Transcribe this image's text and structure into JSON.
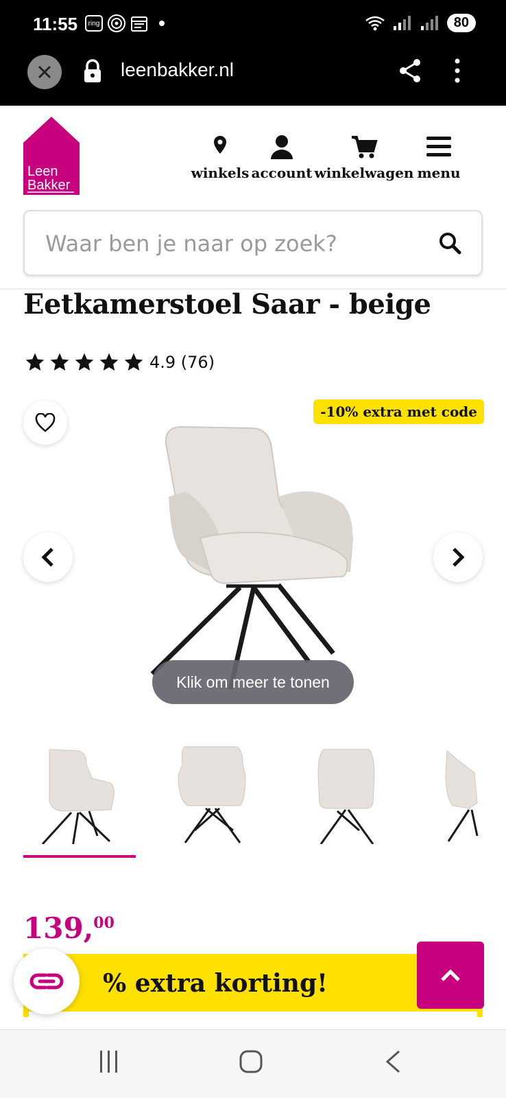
{
  "status_bar": {
    "time": "11:55",
    "icon_ring": "ring",
    "battery": "80"
  },
  "browser": {
    "url": "leenbakker.nl"
  },
  "header": {
    "logo_line1": "Leen",
    "logo_line2": "Bakker",
    "nav": {
      "stores": "winkels",
      "account": "account",
      "cart": "winkelwagen",
      "menu": "menu"
    },
    "search_placeholder": "Waar ben je naar op zoek?"
  },
  "product": {
    "title": "Eetkamerstoel Saar - beige",
    "rating": 4.9,
    "rating_text": "4.9 (76)",
    "promo_badge": "-10% extra met code",
    "more_label": "Klik om meer te tonen",
    "price_main": "139,",
    "price_cents": "00",
    "korting_text": "% extra korting!"
  },
  "colors": {
    "brand": "#c7007d",
    "promo": "#ffe100"
  },
  "icons": [
    "close-icon",
    "lock-icon",
    "share-icon",
    "more-vert-icon",
    "map-pin-icon",
    "user-icon",
    "cart-icon",
    "menu-icon",
    "search-icon",
    "star-icon",
    "heart-icon",
    "chevron-left-icon",
    "chevron-right-icon",
    "chevron-up-icon",
    "link-icon"
  ]
}
